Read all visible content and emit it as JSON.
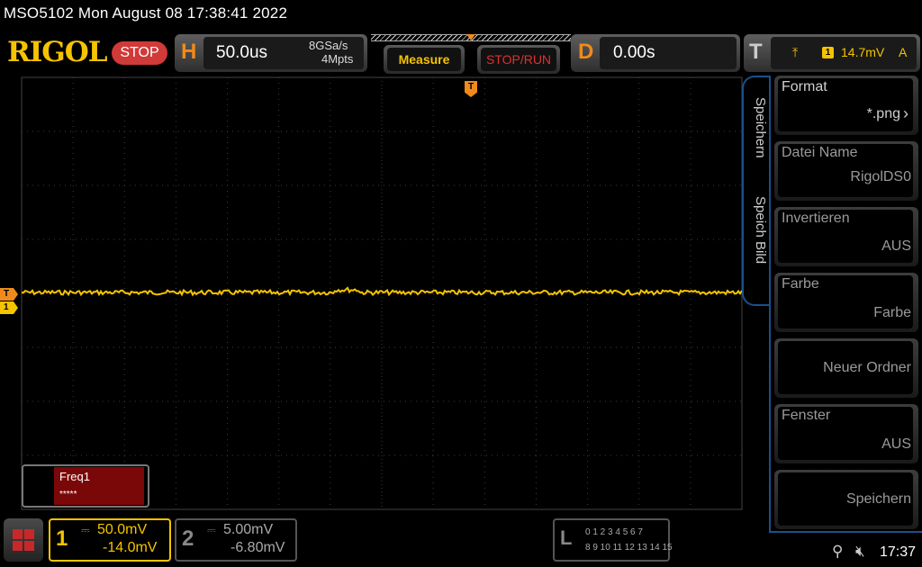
{
  "title_bar": {
    "text": "MSO5102  Mon August 08 17:38:41 2022"
  },
  "header": {
    "brand": "RIGOL",
    "run_state": "STOP",
    "horizontal": {
      "letter": "H",
      "timebase": "50.0us",
      "sample_rate": "8GSa/s",
      "memory_depth": "4Mpts"
    },
    "measure_label": "Measure",
    "stop_run_label": "STOP/RUN",
    "delay": {
      "letter": "D",
      "value": "0.00s"
    },
    "trigger": {
      "letter": "T",
      "edge_icon": "rising-edge-icon",
      "channel": "1",
      "level": "14.7mV",
      "mode": "A"
    }
  },
  "markers": {
    "ch1_offset": "1",
    "trigger_level": "T",
    "trigger_position": "T"
  },
  "measurement": {
    "label": "Freq1",
    "value": "*****"
  },
  "menu": {
    "tabs": [
      "Speichern",
      "Speich Bild"
    ],
    "items": [
      {
        "label": "Format",
        "value": "*.png"
      },
      {
        "label": "Datei Name",
        "value": "RigolDS0"
      },
      {
        "label": "Invertieren",
        "value": "AUS"
      },
      {
        "label": "Farbe",
        "value": "Farbe"
      },
      {
        "label": "",
        "value": "Neuer Ordner"
      },
      {
        "label": "Fenster",
        "value": "AUS"
      },
      {
        "label": "",
        "value": "Speichern"
      }
    ]
  },
  "channels": [
    {
      "num": "1",
      "coupling_icon": "dc-coupling-icon",
      "scale": "50.0mV",
      "offset": "-14.0mV",
      "color": "#f5c400",
      "active": true
    },
    {
      "num": "2",
      "coupling_icon": "dc-coupling-icon",
      "scale": "5.00mV",
      "offset": "-6.80mV",
      "color": "#888888",
      "active": false
    }
  ],
  "logic_analyzer": {
    "letter": "L",
    "row1": "0 1 2 3   4 5 6 7",
    "row2": "8 9 10 11  12 13 14 15"
  },
  "status": {
    "time": "17:37",
    "usb_icon": "usb-icon",
    "speaker_icon": "speaker-muted-icon"
  },
  "colors": {
    "trace": "#f5c400",
    "accent_orange": "#f08a1c",
    "menu_border": "#1c4f8c",
    "stop_red": "#d03a38"
  }
}
